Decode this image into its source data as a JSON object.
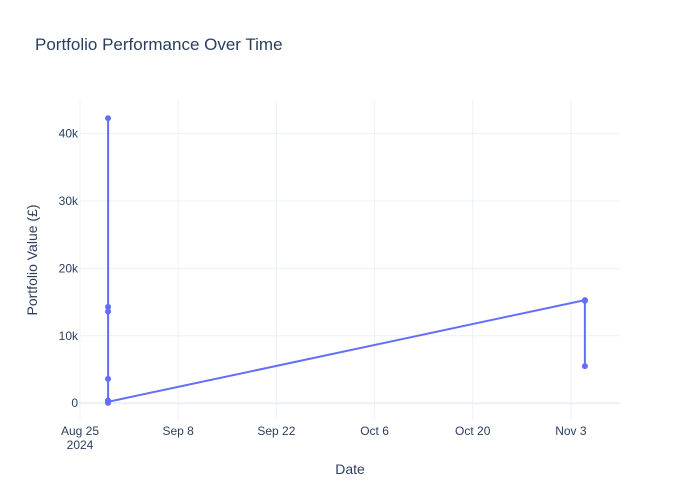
{
  "chart_data": {
    "type": "line",
    "title": "Portfolio Performance Over Time",
    "xlabel": "Date",
    "ylabel": "Portfolio Value (£)",
    "xlim": [
      "2024-08-25",
      "2024-11-10"
    ],
    "ylim": [
      -2500,
      45000
    ],
    "grid": true,
    "x_ticks": [
      {
        "date": "2024-08-25",
        "label": "Aug 25",
        "sublabel": "2024"
      },
      {
        "date": "2024-09-08",
        "label": "Sep 8",
        "sublabel": ""
      },
      {
        "date": "2024-09-22",
        "label": "Sep 22",
        "sublabel": ""
      },
      {
        "date": "2024-10-06",
        "label": "Oct 6",
        "sublabel": ""
      },
      {
        "date": "2024-10-20",
        "label": "Oct 20",
        "sublabel": ""
      },
      {
        "date": "2024-11-03",
        "label": "Nov 3",
        "sublabel": ""
      }
    ],
    "y_ticks": [
      {
        "value": 0,
        "label": "0"
      },
      {
        "value": 10000,
        "label": "10k"
      },
      {
        "value": 20000,
        "label": "20k"
      },
      {
        "value": 30000,
        "label": "30k"
      },
      {
        "value": 40000,
        "label": "40k"
      }
    ],
    "series": [
      {
        "color": "#636efa",
        "points": [
          {
            "x": "2024-08-29",
            "y": 42300
          },
          {
            "x": "2024-08-29",
            "y": 14300
          },
          {
            "x": "2024-08-29",
            "y": 13600
          },
          {
            "x": "2024-08-29",
            "y": 3600
          },
          {
            "x": "2024-08-29",
            "y": 400
          },
          {
            "x": "2024-08-29",
            "y": 50
          },
          {
            "x": "2024-08-29",
            "y": 200
          },
          {
            "x": "2024-11-05",
            "y": 15300
          },
          {
            "x": "2024-11-05",
            "y": 15200
          },
          {
            "x": "2024-11-05",
            "y": 5500
          }
        ]
      }
    ]
  }
}
